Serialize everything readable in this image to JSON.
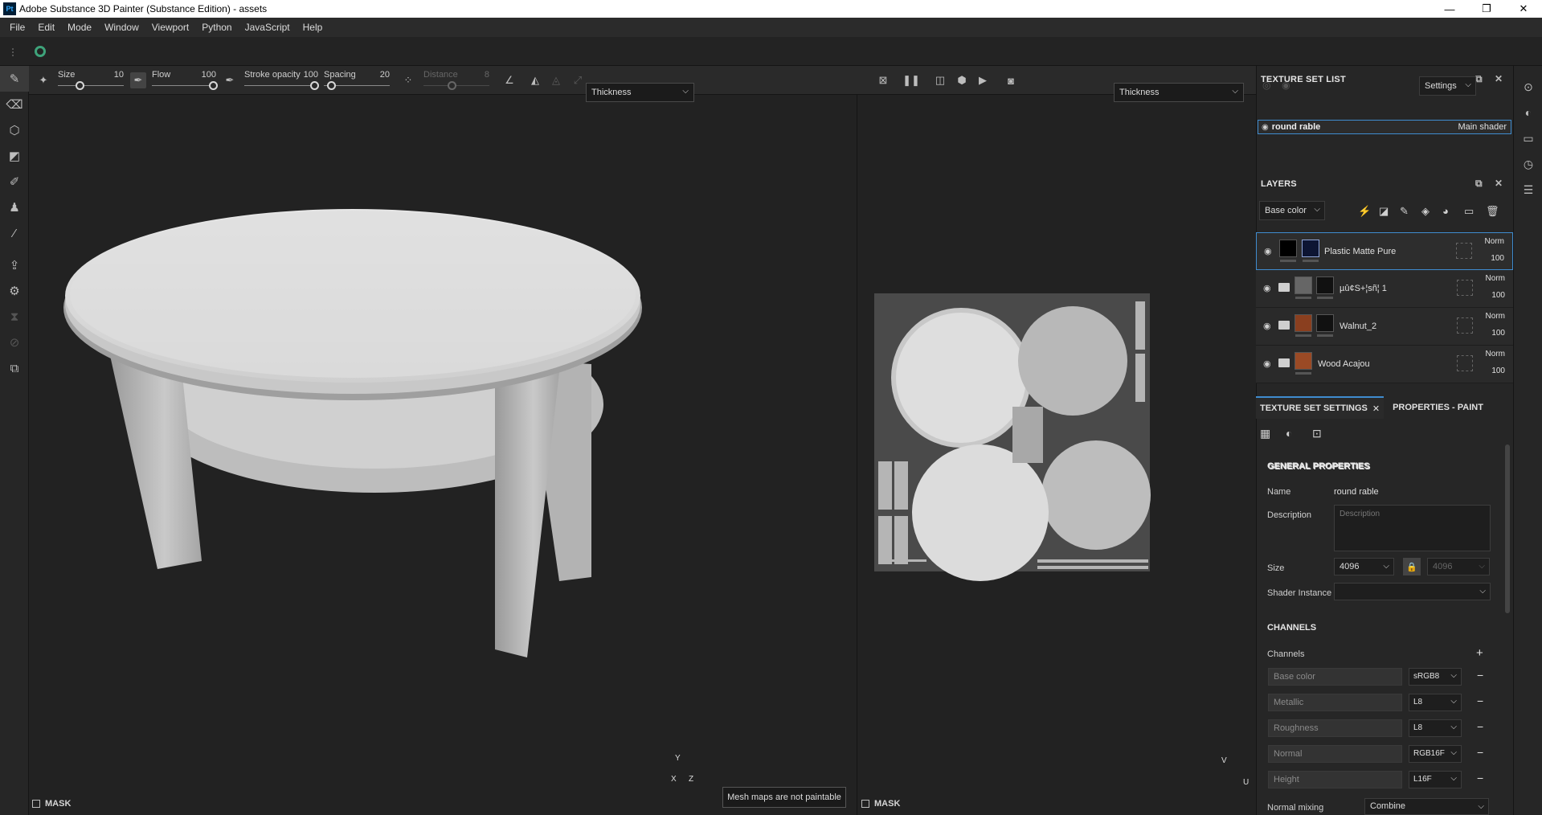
{
  "window": {
    "app_logo": "Pt",
    "title": "Adobe Substance 3D Painter (Substance Edition) - assets",
    "controls": [
      "—",
      "❐",
      "✕"
    ]
  },
  "menu": [
    "File",
    "Edit",
    "Mode",
    "Window",
    "Viewport",
    "Python",
    "JavaScript",
    "Help"
  ],
  "tool_options": {
    "size": {
      "label": "Size",
      "value": "10"
    },
    "flow": {
      "label": "Flow",
      "value": "100"
    },
    "stroke_opacity": {
      "label": "Stroke opacity",
      "value": "100"
    },
    "spacing": {
      "label": "Spacing",
      "value": "20"
    },
    "distance": {
      "label": "Distance",
      "value": "8"
    }
  },
  "viewport_3d": {
    "channel_select": "Thickness",
    "mask_label": "MASK",
    "axis": [
      "Y",
      "X",
      "Z"
    ]
  },
  "viewport_2d": {
    "channel_select": "Thickness",
    "mask_label": "MASK",
    "axis": [
      "V",
      "U"
    ]
  },
  "tooltip": "Mesh maps are not paintable",
  "texture_set_list": {
    "title": "TEXTURE SET LIST",
    "settings_label": "Settings",
    "item": {
      "name": "round rable",
      "shader": "Main shader"
    }
  },
  "layers": {
    "title": "LAYERS",
    "channel_select": "Base color",
    "items": [
      {
        "name": "Plastic Matte Pure",
        "blend": "Norm",
        "opacity": "100",
        "folder": false
      },
      {
        "name": "µû¢S+¦sñ¦ 1",
        "blend": "Norm",
        "opacity": "100",
        "folder": true
      },
      {
        "name": "Walnut_2",
        "blend": "Norm",
        "opacity": "100",
        "folder": true
      },
      {
        "name": "Wood Acajou",
        "blend": "Norm",
        "opacity": "100",
        "folder": true
      }
    ]
  },
  "tabs": {
    "texture_set_settings": "TEXTURE SET SETTINGS",
    "properties_paint": "PROPERTIES - PAINT"
  },
  "general_properties": {
    "title": "GENERAL PROPERTIES",
    "name_label": "Name",
    "name_value": "round rable",
    "description_label": "Description",
    "description_placeholder": "Description",
    "size_label": "Size",
    "size_value": "4096",
    "size_value_locked": "4096",
    "shader_instance_label": "Shader Instance"
  },
  "channels": {
    "title": "CHANNELS",
    "channels_label": "Channels",
    "items": [
      {
        "name": "Base color",
        "format": "sRGB8"
      },
      {
        "name": "Metallic",
        "format": "L8"
      },
      {
        "name": "Roughness",
        "format": "L8"
      },
      {
        "name": "Normal",
        "format": "RGB16F"
      },
      {
        "name": "Height",
        "format": "L16F"
      }
    ],
    "normal_mixing_label": "Normal mixing",
    "normal_mixing_value": "Combine"
  }
}
